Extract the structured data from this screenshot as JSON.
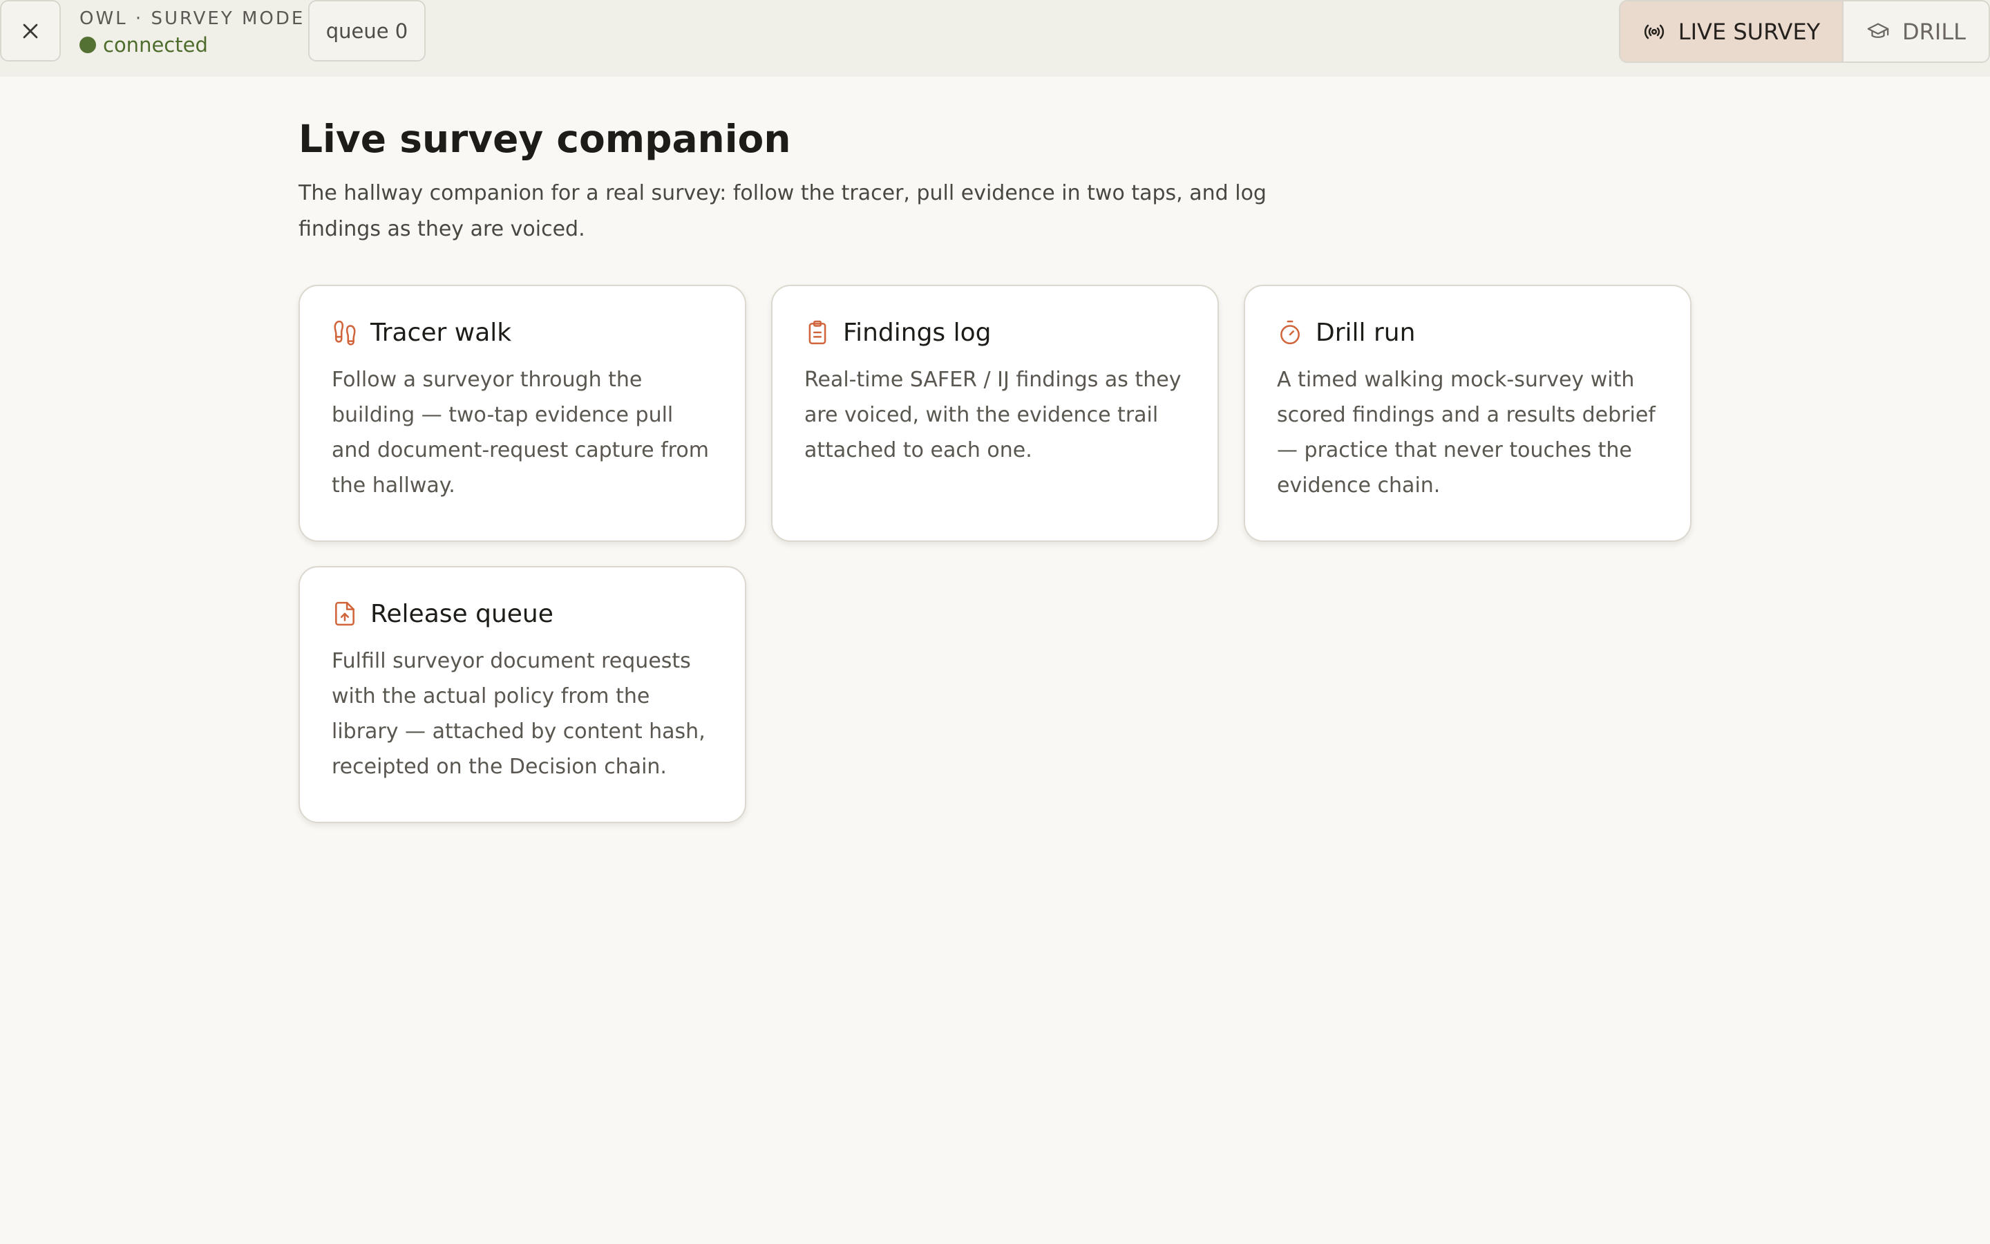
{
  "header": {
    "close_icon": "close-icon",
    "brand_title": "OWL · SURVEY MODE",
    "status_text": "connected",
    "status_color": "#527132",
    "queue_label": "queue 0",
    "modes": [
      {
        "label": "LIVE SURVEY",
        "icon": "broadcast-icon",
        "active": true
      },
      {
        "label": "DRILL",
        "icon": "graduation-cap-icon",
        "active": false
      }
    ]
  },
  "main": {
    "title": "Live survey companion",
    "description": "The hallway companion for a real survey: follow the tracer, pull evidence in two taps, and log findings as they are voiced.",
    "accent_color": "#d0643a",
    "cards": [
      {
        "title": "Tracer walk",
        "icon": "footprints-icon",
        "body": "Follow a surveyor through the building — two-tap evidence pull and document-request capture from the hallway."
      },
      {
        "title": "Findings log",
        "icon": "clipboard-icon",
        "body": "Real-time SAFER / IJ findings as they are voiced, with the evidence trail attached to each one."
      },
      {
        "title": "Drill run",
        "icon": "stopwatch-icon",
        "body": "A timed walking mock-survey with scored findings and a results debrief — practice that never touches the evidence chain."
      },
      {
        "title": "Release queue",
        "icon": "file-upload-icon",
        "body": "Fulfill surveyor document requests with the actual policy from the library — attached by content hash, receipted on the Decision chain."
      }
    ]
  }
}
